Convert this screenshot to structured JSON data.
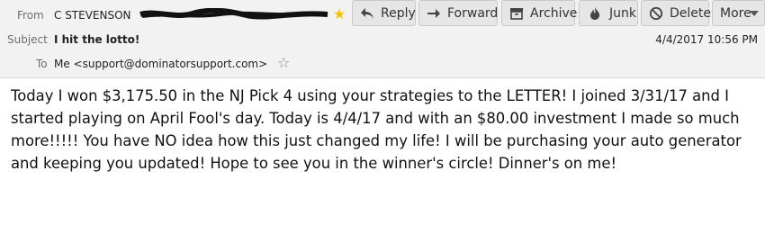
{
  "header": {
    "from_label": "From",
    "from_name": "C STEVENSON",
    "subject_label": "Subject",
    "subject": "I hit the lotto!",
    "date": "4/4/2017 10:56 PM",
    "to_label": "To",
    "to": "Me <support@dominatorsupport.com>"
  },
  "toolbar": {
    "reply": "Reply",
    "forward": "Forward",
    "archive": "Archive",
    "junk": "Junk",
    "delete": "Delete",
    "more": "More"
  },
  "message": {
    "body": "Today I won $3,175.50 in the NJ Pick 4 using your strategies to the LETTER! I joined 3/31/17 and I started playing on April Fool's day. Today is 4/4/17 and with an $80.00 investment I made so much more!!!!! You have NO idea how this just changed my life! I will be purchasing your auto generator and keeping you updated! Hope to see you in the winner's circle! Dinner's on me!"
  },
  "icons": {
    "star_from": "star-icon",
    "star_to": "star-outline-icon",
    "reply": "reply-arrow-icon",
    "forward": "forward-arrow-icon",
    "archive": "archive-box-icon",
    "junk": "flame-icon",
    "delete": "no-entry-icon",
    "more": "chevron-down-icon"
  },
  "colors": {
    "header_bg": "#f2f2f2",
    "button_bg": "#e6e6e6",
    "star": "#f5c400"
  }
}
